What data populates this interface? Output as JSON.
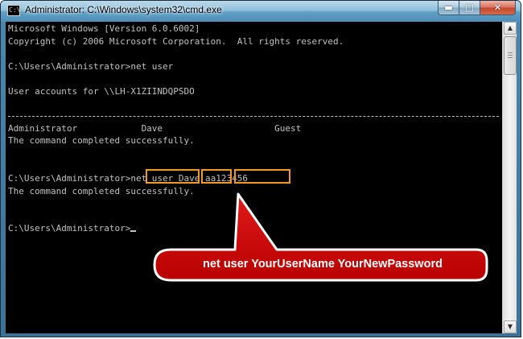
{
  "window": {
    "title": "Administrator: C:\\Windows\\system32\\cmd.exe",
    "icon_label": "C:\\",
    "buttons": {
      "minimize": "minimize-icon",
      "maximize": "maximize-icon",
      "close": "close-icon"
    }
  },
  "console": {
    "lines": [
      "Microsoft Windows [Version 6.0.6002]",
      "Copyright (c) 2006 Microsoft Corporation.  All rights reserved.",
      "C:\\Users\\Administrator>net user",
      "User accounts for \\\\LH-X1ZIINDQPSDO",
      "Administrator            Dave                     Guest",
      "The command completed successfully.",
      "C:\\Users\\Administrator>net user Dave aa123456",
      "The command completed successfully.",
      "C:\\Users\\Administrator>"
    ]
  },
  "callout": {
    "text": "net user YourUserName YourNewPassword"
  },
  "colors": {
    "console_bg": "#000000",
    "console_text": "#c0c0c0",
    "highlight_border": "#f29a1c",
    "callout_fill": "#cc0000"
  }
}
